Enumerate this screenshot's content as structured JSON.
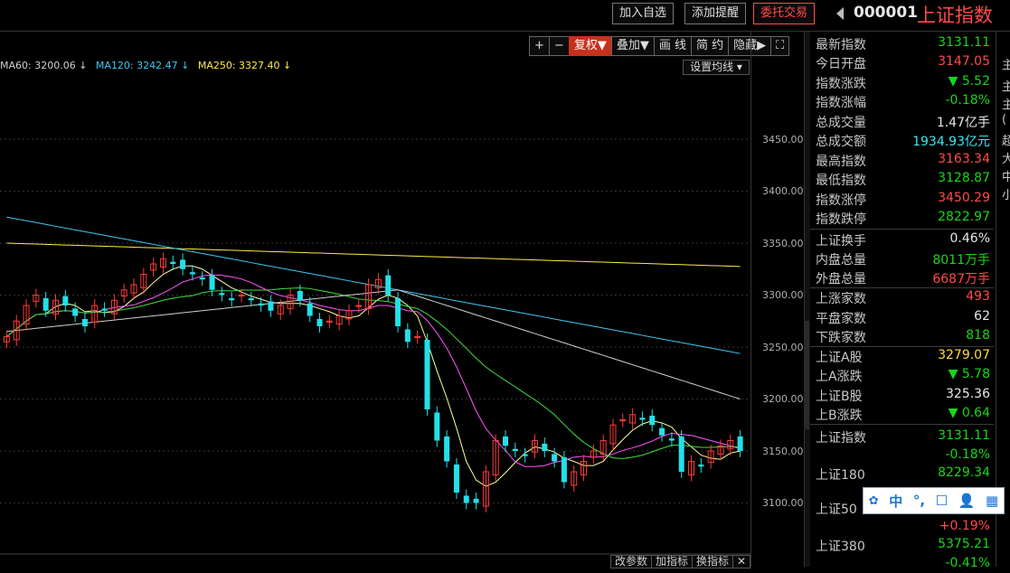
{
  "header": {
    "buttons": [
      "加入自选",
      "添加提醒",
      "委托交易"
    ],
    "code": "000001",
    "name": "上证指数"
  },
  "toolbar": [
    "+",
    "−",
    "复权▼",
    "叠加▼",
    "画 线",
    "简 约",
    "隐藏▶",
    "⛶"
  ],
  "ma_legend": [
    {
      "text": "MA60: 3200.06 ↓",
      "color": "#d0d0d0"
    },
    {
      "text": "MA120: 3242.47 ↓",
      "color": "#3ec8f0"
    },
    {
      "text": "MA250: 3327.40 ↓",
      "color": "#ffe94a"
    }
  ],
  "set_ma": "设置均线 ▾",
  "y_ticks": [
    "3450.00",
    "3400.00",
    "3350.00",
    "3300.00",
    "3250.00",
    "3200.00",
    "3150.00",
    "3100.00"
  ],
  "colors": {
    "up": "#ff3a3a",
    "down": "#22e0e8",
    "panel_green": "#19d619",
    "panel_red": "#ff4b4b"
  },
  "panel": {
    "rows1": [
      {
        "label": "最新指数",
        "value": "3131.11",
        "color": "green"
      },
      {
        "label": "今日开盘",
        "value": "3147.05",
        "color": "red2"
      },
      {
        "label": "指数涨跌",
        "value": "▼ 5.52",
        "color": "green"
      },
      {
        "label": "指数涨幅",
        "value": "-0.18%",
        "color": "green"
      },
      {
        "label": "总成交量",
        "value": "1.47亿手",
        "color": "white"
      },
      {
        "label": "总成交额",
        "value": "1934.93亿元",
        "color": "cyan"
      },
      {
        "label": "最高指数",
        "value": "3163.34",
        "color": "red2"
      },
      {
        "label": "最低指数",
        "value": "3128.87",
        "color": "green"
      },
      {
        "label": "指数涨停",
        "value": "3450.29",
        "color": "red2"
      },
      {
        "label": "指数跌停",
        "value": "2822.97",
        "color": "green"
      }
    ],
    "rows2": [
      {
        "label": "上证换手",
        "value": "0.46%",
        "color": "white"
      },
      {
        "label": "内盘总量",
        "value": "8011万手",
        "color": "green"
      },
      {
        "label": "外盘总量",
        "value": "6687万手",
        "color": "red2"
      }
    ],
    "rows3": [
      {
        "label": "上涨家数",
        "value": "493",
        "color": "red2"
      },
      {
        "label": "平盘家数",
        "value": "62",
        "color": "white"
      },
      {
        "label": "下跌家数",
        "value": "818",
        "color": "green"
      }
    ],
    "rows4": [
      {
        "label": "上证A股",
        "value": "3279.07",
        "color": "yellow"
      },
      {
        "label": "上A涨跌",
        "value": "▼ 5.78",
        "color": "green"
      },
      {
        "label": "上证B股",
        "value": "325.36",
        "color": "white"
      },
      {
        "label": "上B涨跌",
        "value": "▼ 0.64",
        "color": "green"
      }
    ],
    "rows5": [
      {
        "label": "上证指数",
        "value": "3131.11",
        "color": "green"
      },
      {
        "label": "",
        "value": "-0.18%",
        "color": "green"
      },
      {
        "label": "上证180",
        "value": "8229.34",
        "color": "green"
      },
      {
        "label": "",
        "value": "",
        "color": "green"
      },
      {
        "label": "上证50",
        "value": "",
        "color": "green"
      },
      {
        "label": "",
        "value": "+0.19%",
        "color": "red2"
      },
      {
        "label": "上证380",
        "value": "5375.21",
        "color": "green"
      },
      {
        "label": "",
        "value": "-0.41%",
        "color": "green"
      }
    ]
  },
  "right_strip": [
    "主",
    "主",
    "主",
    "(",
    "超",
    "大",
    "中",
    "小"
  ],
  "ime": [
    "中",
    "°,",
    "☐",
    "👤",
    "▦"
  ],
  "bottom_buttons": [
    "改参数",
    "加指标",
    "换指标",
    "✕"
  ]
}
